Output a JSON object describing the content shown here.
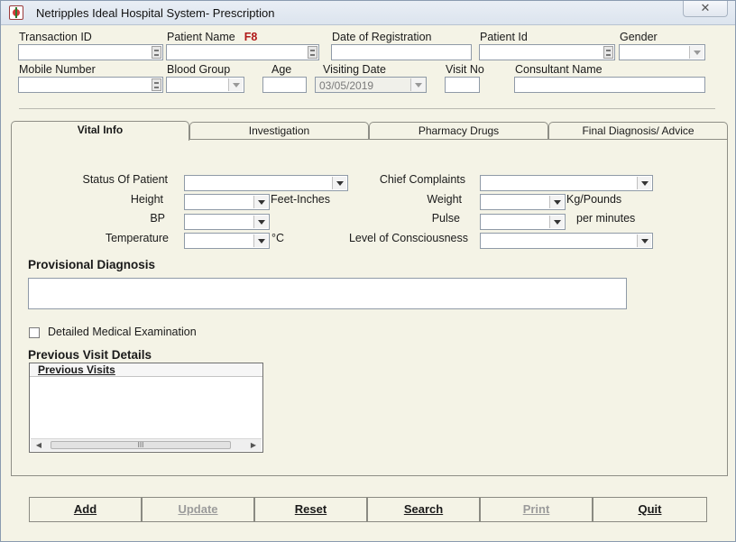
{
  "window": {
    "title": "Netripples Ideal Hospital System- Prescription",
    "close_label": "✕"
  },
  "header": {
    "transaction_id": {
      "label": "Transaction ID",
      "value": ""
    },
    "patient_name": {
      "label": "Patient Name",
      "hotkey": "F8",
      "value": ""
    },
    "date_of_registration": {
      "label": "Date of Registration",
      "value": ""
    },
    "patient_id": {
      "label": "Patient Id",
      "value": ""
    },
    "gender": {
      "label": "Gender",
      "value": ""
    },
    "mobile_number": {
      "label": "Mobile Number",
      "value": ""
    },
    "blood_group": {
      "label": "Blood Group",
      "value": ""
    },
    "age": {
      "label": "Age",
      "value": ""
    },
    "visiting_date": {
      "label": "Visiting Date",
      "value": "03/05/2019"
    },
    "visit_no": {
      "label": "Visit No",
      "value": ""
    },
    "consultant_name": {
      "label": "Consultant Name",
      "value": ""
    }
  },
  "tabs": [
    {
      "label": "Vital Info",
      "active": true
    },
    {
      "label": "Investigation",
      "active": false
    },
    {
      "label": "Pharmacy Drugs",
      "active": false
    },
    {
      "label": "Final Diagnosis/ Advice",
      "active": false
    }
  ],
  "vital_info": {
    "status_of_patient": {
      "label": "Status Of Patient",
      "value": ""
    },
    "chief_complaints": {
      "label": "Chief Complaints",
      "value": ""
    },
    "height": {
      "label": "Height",
      "unit": "Feet-Inches",
      "value": ""
    },
    "weight": {
      "label": "Weight",
      "unit": "Kg/Pounds",
      "value": ""
    },
    "bp": {
      "label": "BP",
      "value": ""
    },
    "pulse": {
      "label": "Pulse",
      "unit": "per minutes",
      "value": ""
    },
    "temperature": {
      "label": "Temperature",
      "unit": "°C",
      "value": ""
    },
    "level_of_consciousness": {
      "label": "Level of Consciousness",
      "value": ""
    },
    "provisional_diagnosis": {
      "label": "Provisional Diagnosis",
      "value": ""
    },
    "detailed_exam": {
      "label": "Detailed Medical  Examination",
      "checked": false
    },
    "previous_visit_details": {
      "label": "Previous Visit Details",
      "column_header": "Previous Visits",
      "rows": [],
      "scroll_thumb_label": "III"
    }
  },
  "buttons": [
    {
      "label": "Add",
      "enabled": true
    },
    {
      "label": "Update",
      "enabled": false
    },
    {
      "label": "Reset",
      "enabled": true
    },
    {
      "label": "Search",
      "enabled": true
    },
    {
      "label": "Print",
      "enabled": false
    },
    {
      "label": "Quit",
      "enabled": true
    }
  ],
  "icons": {
    "app": "hospital-cross-icon",
    "spin": "spin-icon",
    "dropdown": "chevron-down-icon",
    "scroll_left": "arrow-left-icon",
    "scroll_right": "arrow-right-icon"
  }
}
